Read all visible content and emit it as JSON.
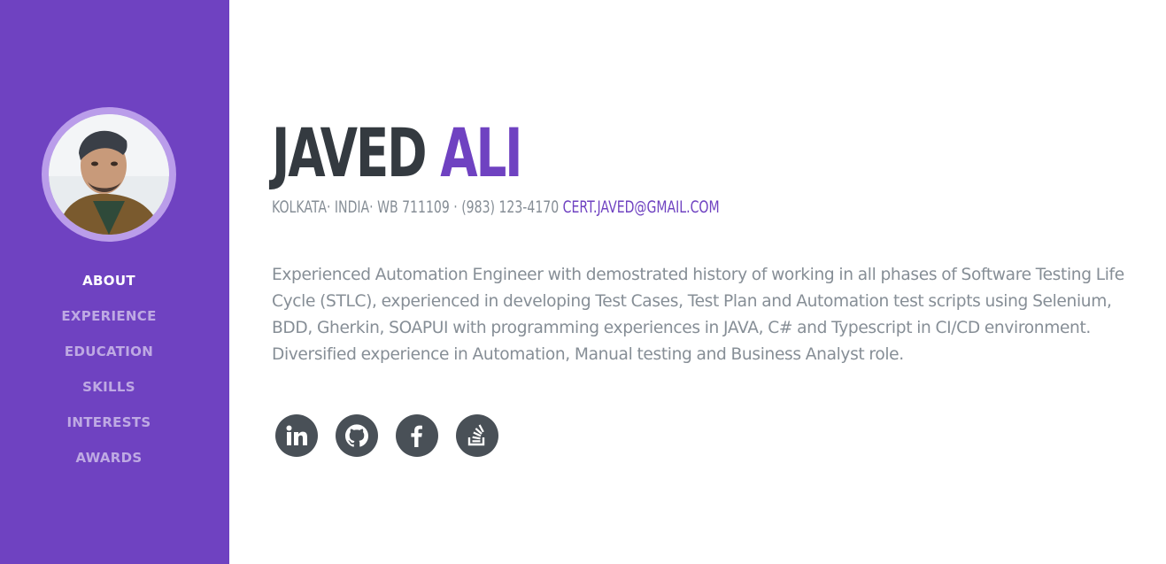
{
  "sidebar": {
    "nav": [
      {
        "label": "ABOUT",
        "active": true
      },
      {
        "label": "EXPERIENCE",
        "active": false
      },
      {
        "label": "EDUCATION",
        "active": false
      },
      {
        "label": "SKILLS",
        "active": false
      },
      {
        "label": "INTERESTS",
        "active": false
      },
      {
        "label": "AWARDS",
        "active": false
      }
    ]
  },
  "header": {
    "first_name": "JAVED",
    "last_name": "ALI",
    "contact": "KOLKATA· INDIA· WB 711109 · (983) 123-4170",
    "email": "CERT.JAVED@GMAIL.COM"
  },
  "about": {
    "summary": "Experienced Automation Engineer with demostrated history of working in all phases of Software Testing Life Cycle (STLC), experienced in developing Test Cases, Test Plan and Automation test scripts using Selenium, BDD, Gherkin, SOAPUI with programming experiences in JAVA, C# and Typescript in CI/CD environment. Diversified experience in Automation, Manual testing and Business Analyst role."
  },
  "social": [
    {
      "icon": "linkedin-icon"
    },
    {
      "icon": "github-icon"
    },
    {
      "icon": "facebook-icon"
    },
    {
      "icon": "stackoverflow-icon"
    }
  ],
  "colors": {
    "primary": "#6f42c1",
    "dark": "#343a40",
    "muted": "#868e96",
    "icon_bg": "#495057"
  }
}
